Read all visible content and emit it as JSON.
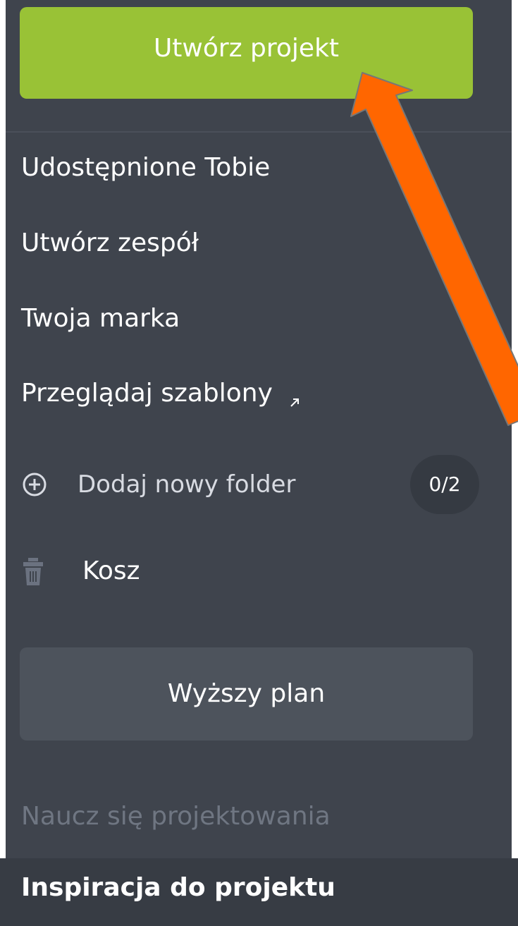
{
  "sidebar": {
    "create_project": "Utwórz projekt",
    "items": [
      {
        "label": "Udostępnione Tobie"
      },
      {
        "label": "Utwórz zespół"
      },
      {
        "label": "Twoja marka"
      },
      {
        "label": "Przeglądaj szablony",
        "icon": "external-link-icon"
      }
    ],
    "folder": {
      "label": "Dodaj nowy folder",
      "count": "0/2",
      "icon": "plus-circle-icon"
    },
    "trash": {
      "label": "Kosz",
      "icon": "trash-icon"
    },
    "upgrade": "Wyższy plan",
    "learn": "Naucz się projektowania"
  },
  "footer": {
    "inspiration": "Inspiracja do projektu"
  },
  "colors": {
    "sidebar_background": "#3f444d",
    "create_button": "#99c236",
    "upgrade_button": "#4d535c",
    "annotation_arrow": "#ff6600"
  }
}
